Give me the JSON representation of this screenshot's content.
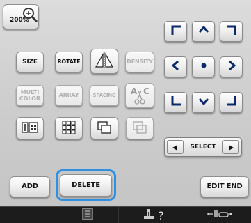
{
  "zoom": {
    "label": "200%",
    "icon": "magnifier-plus-icon"
  },
  "edit_buttons": {
    "size": "SIZE",
    "rotate": "ROTATE",
    "flip": "flip-icon",
    "density": "DENSITY",
    "multi_color": "MULTI\nCOLOR",
    "array": "ARRAY",
    "spacing": "SPACING",
    "alphabet_edit": "A C",
    "border": "border-icon",
    "repeat": "repeat-icon",
    "group": "group-icon",
    "outline": "outline-icon"
  },
  "layout_pad": {
    "select_label": "SELECT"
  },
  "footer": {
    "add": "ADD",
    "delete": "DELETE",
    "edit_end": "EDIT END"
  },
  "bottom_bar": {
    "help_label": "?"
  },
  "colors": {
    "highlight": "#2f8fe0",
    "bottom_bar": "#1c1c1c"
  }
}
